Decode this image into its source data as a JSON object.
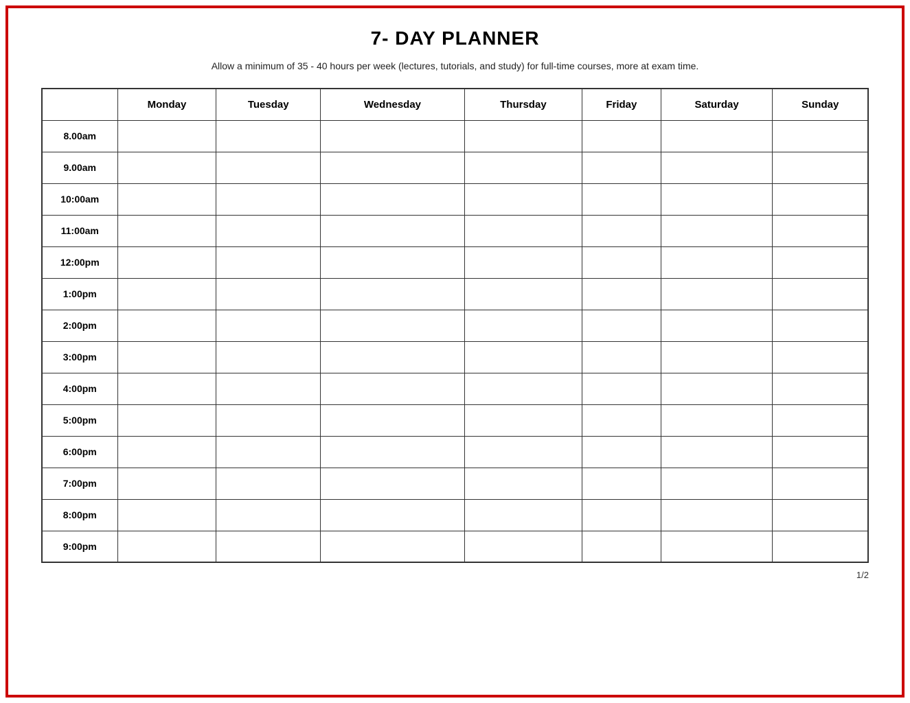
{
  "title": "7- DAY PLANNER",
  "subtitle": "Allow a minimum of 35 - 40 hours per week (lectures, tutorials, and study) for full-time courses, more at exam time.",
  "page_number": "1/2",
  "columns": [
    "",
    "Monday",
    "Tuesday",
    "Wednesday",
    "Thursday",
    "Friday",
    "Saturday",
    "Sunday"
  ],
  "time_slots": [
    "8.00am",
    "9.00am",
    "10:00am",
    "11:00am",
    "12:00pm",
    "1:00pm",
    "2:00pm",
    "3:00pm",
    "4:00pm",
    "5:00pm",
    "6:00pm",
    "7:00pm",
    "8:00pm",
    "9:00pm"
  ]
}
